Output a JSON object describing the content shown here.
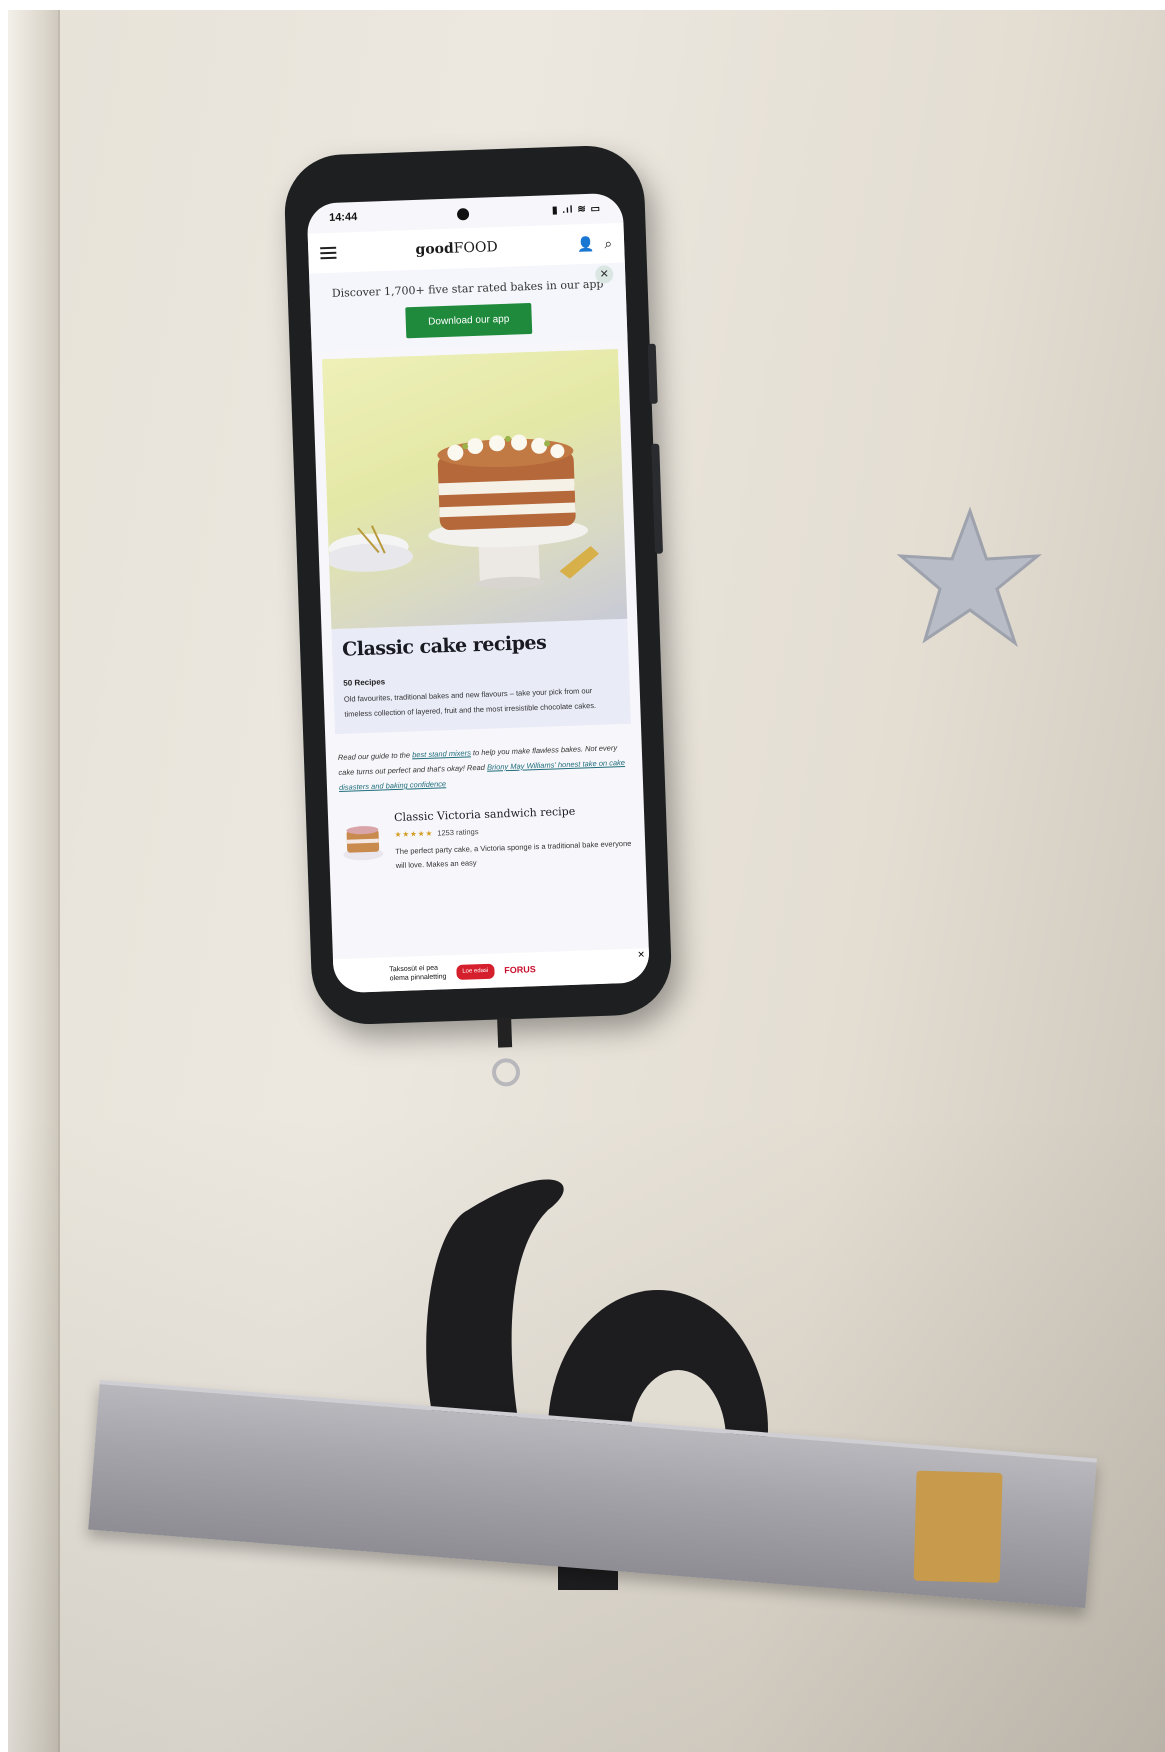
{
  "status_bar": {
    "time": "14:44",
    "system_icons": "▮ .ıl ≋ ▭"
  },
  "site": {
    "logo_bold": "good",
    "logo_light": "FOOD"
  },
  "promo": {
    "text": "Discover 1,700+ five star rated bakes in our app",
    "button": "Download our app"
  },
  "page": {
    "title": "Classic cake recipes",
    "count": "50 Recipes",
    "description": "Old favourites, traditional bakes and new flavours – take your pick from our timeless collection of layered, fruit and the most irresistible chocolate cakes."
  },
  "intro": {
    "prefix": "Read our guide to the ",
    "link1": "best stand mixers",
    "middle": " to help you make flawless bakes. Not every cake turns out perfect and that's okay! Read ",
    "link2": "Briony May Williams' honest take on cake disasters and baking confidence"
  },
  "card": {
    "title": "Classic Victoria sandwich recipe",
    "stars": "★★★★★",
    "ratings": "1253 ratings",
    "description": "The perfect party cake, a Victoria sponge is a traditional bake everyone will love. Makes an easy"
  },
  "ad": {
    "line1": "Taksosüt ei pea",
    "line2": "olema pinnaletting",
    "button": "Loe edasi",
    "brand": "FORUS",
    "close": "✕"
  },
  "colors": {
    "accent_green": "#1f8a3c",
    "link_teal": "#1f6d7a",
    "star_gold": "#d49b1e"
  }
}
